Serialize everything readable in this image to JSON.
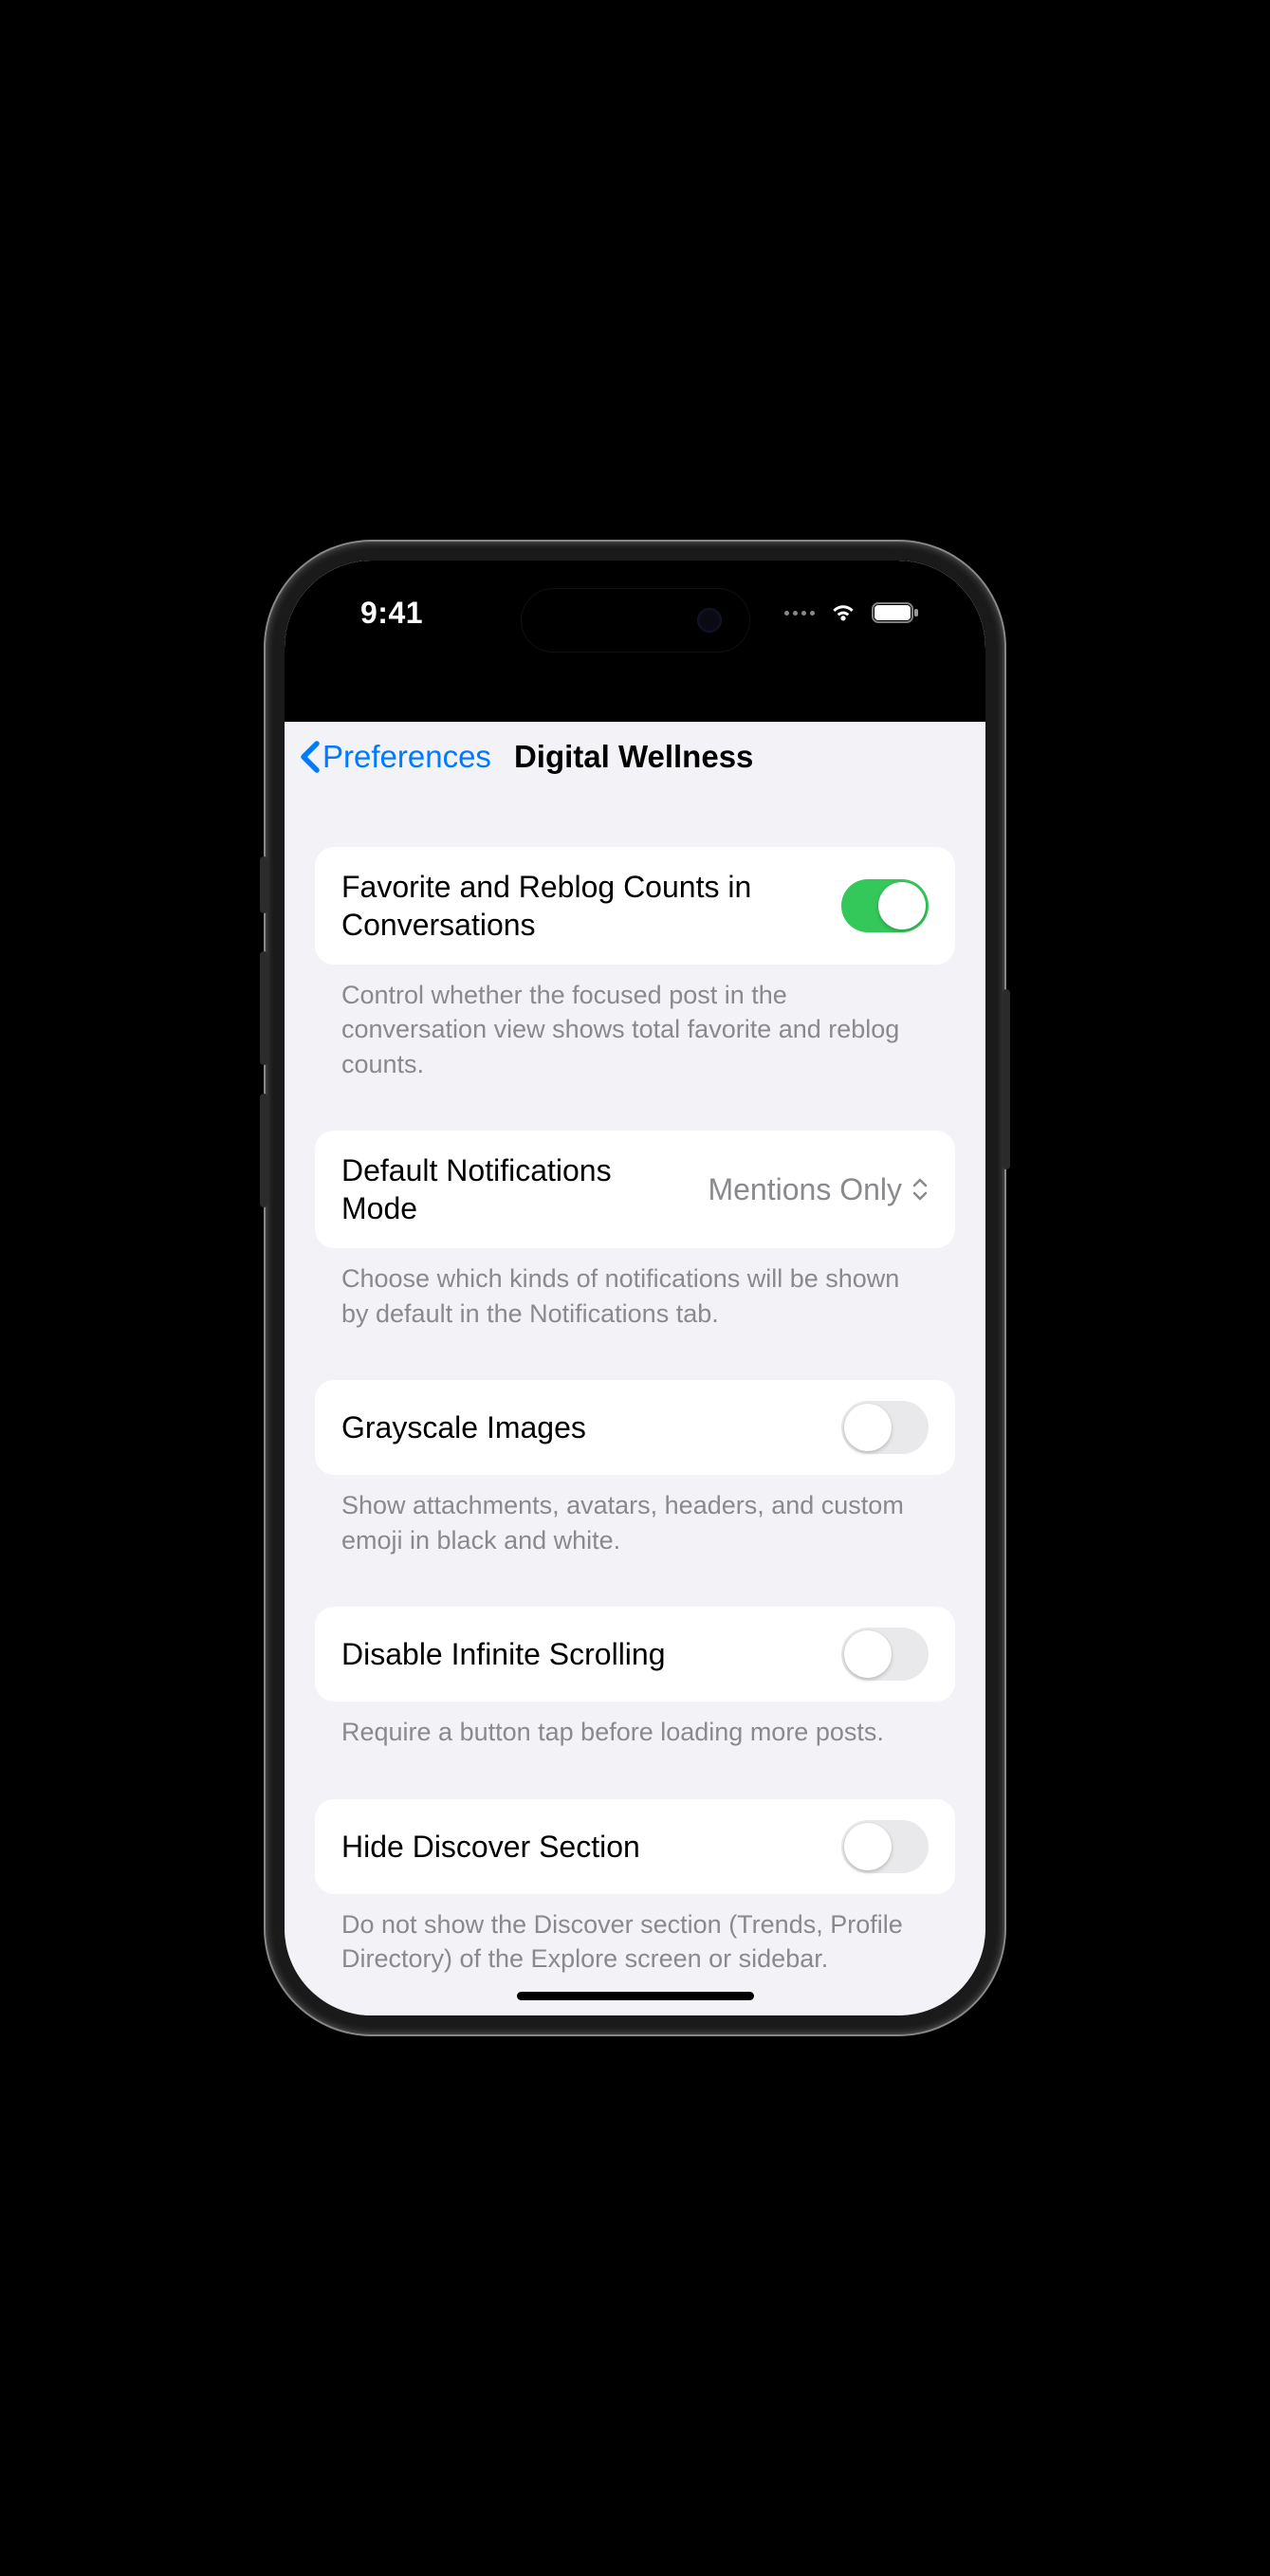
{
  "status": {
    "time": "9:41"
  },
  "nav": {
    "back_label": "Preferences",
    "title": "Digital Wellness"
  },
  "sections": {
    "fav_reblog": {
      "title": "Favorite and Reblog Counts in Conversations",
      "footer": "Control whether the focused post in the conversation view shows total favorite and reblog counts.",
      "on": true
    },
    "notif_mode": {
      "title": "Default Notifications Mode",
      "value": "Mentions Only",
      "footer": "Choose which kinds of notifications will be shown by default in the Notifications tab."
    },
    "grayscale": {
      "title": "Grayscale Images",
      "footer": "Show attachments, avatars, headers, and custom emoji in black and white.",
      "on": false
    },
    "infinite": {
      "title": "Disable Infinite Scrolling",
      "footer": "Require a button tap before loading more posts.",
      "on": false
    },
    "discover": {
      "title": "Hide Discover Section",
      "footer": "Do not show the Discover section (Trends, Profile Directory) of the Explore screen or sidebar.",
      "on": false
    }
  }
}
